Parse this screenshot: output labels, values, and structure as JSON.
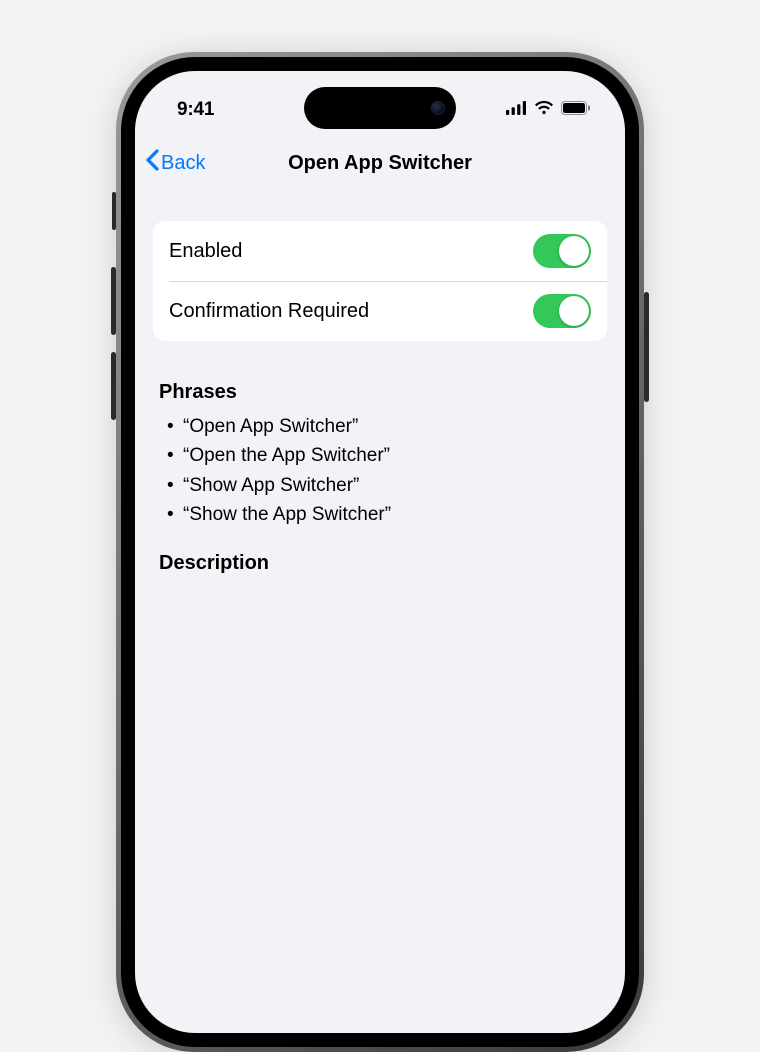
{
  "status": {
    "time": "9:41"
  },
  "nav": {
    "back_label": "Back",
    "title": "Open App Switcher"
  },
  "rows": [
    {
      "label": "Enabled",
      "on": true
    },
    {
      "label": "Confirmation Required",
      "on": true
    }
  ],
  "sections": {
    "phrases_header": "Phrases",
    "phrases": [
      "“Open App Switcher”",
      "“Open the App Switcher”",
      "“Show App Switcher”",
      "“Show the App Switcher”"
    ],
    "description_header": "Description"
  },
  "colors": {
    "ios_blue": "#007aff",
    "toggle_green": "#34c759",
    "screen_bg": "#f2f2f7"
  }
}
